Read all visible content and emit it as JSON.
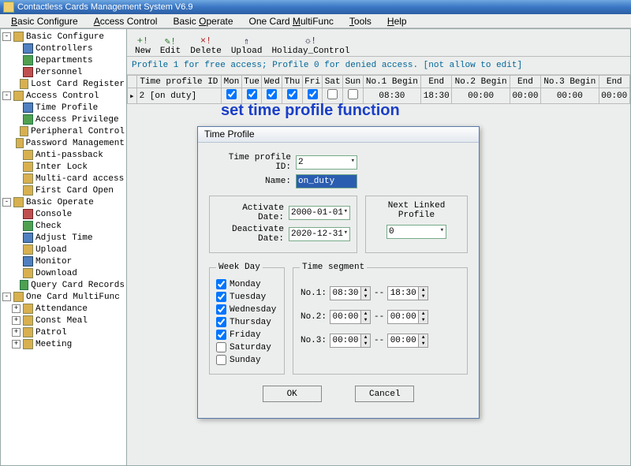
{
  "window": {
    "title": "Contactless Cards Management System  V6.9"
  },
  "menubar": [
    "Basic Configure",
    "Access Control",
    "Basic Operate",
    "One Card MultiFunc",
    "Tools",
    "Help"
  ],
  "menubar_underline": [
    0,
    0,
    6,
    9,
    0,
    0
  ],
  "tree": [
    {
      "depth": 0,
      "exp": "-",
      "ico": "",
      "label": "Basic Configure"
    },
    {
      "depth": 1,
      "exp": "",
      "ico": "blu",
      "label": "Controllers"
    },
    {
      "depth": 1,
      "exp": "",
      "ico": "grn",
      "label": "Departments"
    },
    {
      "depth": 1,
      "exp": "",
      "ico": "red",
      "label": "Personnel"
    },
    {
      "depth": 1,
      "exp": "",
      "ico": "",
      "label": "Lost Card Register"
    },
    {
      "depth": 0,
      "exp": "-",
      "ico": "",
      "label": "Access Control"
    },
    {
      "depth": 1,
      "exp": "",
      "ico": "blu",
      "label": "Time Profile"
    },
    {
      "depth": 1,
      "exp": "",
      "ico": "grn",
      "label": "Access Privilege"
    },
    {
      "depth": 1,
      "exp": "",
      "ico": "",
      "label": "Peripheral Control"
    },
    {
      "depth": 1,
      "exp": "",
      "ico": "",
      "label": "Password Management"
    },
    {
      "depth": 1,
      "exp": "",
      "ico": "",
      "label": "Anti-passback"
    },
    {
      "depth": 1,
      "exp": "",
      "ico": "",
      "label": "Inter Lock"
    },
    {
      "depth": 1,
      "exp": "",
      "ico": "",
      "label": "Multi-card access"
    },
    {
      "depth": 1,
      "exp": "",
      "ico": "",
      "label": "First Card Open"
    },
    {
      "depth": 0,
      "exp": "-",
      "ico": "",
      "label": "Basic Operate"
    },
    {
      "depth": 1,
      "exp": "",
      "ico": "red",
      "label": "Console"
    },
    {
      "depth": 1,
      "exp": "",
      "ico": "grn",
      "label": "Check"
    },
    {
      "depth": 1,
      "exp": "",
      "ico": "blu",
      "label": "Adjust Time"
    },
    {
      "depth": 1,
      "exp": "",
      "ico": "",
      "label": "Upload"
    },
    {
      "depth": 1,
      "exp": "",
      "ico": "blu",
      "label": "Monitor"
    },
    {
      "depth": 1,
      "exp": "",
      "ico": "",
      "label": "Download"
    },
    {
      "depth": 1,
      "exp": "",
      "ico": "grn",
      "label": "Query Card Records"
    },
    {
      "depth": 0,
      "exp": "-",
      "ico": "",
      "label": "One Card MultiFunc"
    },
    {
      "depth": 1,
      "exp": "+",
      "ico": "",
      "label": "Attendance"
    },
    {
      "depth": 1,
      "exp": "+",
      "ico": "",
      "label": "Const Meal"
    },
    {
      "depth": 1,
      "exp": "+",
      "ico": "",
      "label": "Patrol"
    },
    {
      "depth": 1,
      "exp": "+",
      "ico": "",
      "label": "Meeting"
    }
  ],
  "toolbar": [
    {
      "icon": "+!",
      "cls": "",
      "label": "New"
    },
    {
      "icon": "✎!",
      "cls": "",
      "label": "Edit"
    },
    {
      "icon": "×!",
      "cls": "r",
      "label": "Delete"
    },
    {
      "icon": "⇑",
      "cls": "b",
      "label": "Upload"
    },
    {
      "icon": "☼!",
      "cls": "b",
      "label": "Holiday_Control"
    }
  ],
  "hint": "Profile 1 for free access; Profile 0  for denied access.  [not allow to edit]",
  "grid": {
    "headers": [
      "",
      "Time profile ID",
      "Mon",
      "Tue",
      "Wed",
      "Thu",
      "Fri",
      "Sat",
      "Sun",
      "No.1 Begin",
      "End",
      "No.2 Begin",
      "End",
      "No.3 Begin",
      "End"
    ],
    "row": {
      "mark": "▸",
      "id": "2 [on duty]",
      "days": [
        true,
        true,
        true,
        true,
        true,
        false,
        false
      ],
      "t1b": "08:30",
      "t1e": "18:30",
      "t2b": "00:00",
      "t2e": "00:00",
      "t3b": "00:00",
      "t3e": "00:00"
    }
  },
  "heading": "set time profile function",
  "dialog": {
    "title": "Time Profile",
    "labels": {
      "profile_id": "Time profile ID:",
      "name": "Name:",
      "activate": "Activate Date:",
      "deactivate": "Deactivate Date:",
      "next_linked": "Next Linked Profile",
      "weekday": "Week Day",
      "timeseg": "Time segment",
      "no1": "No.1:",
      "no2": "No.2:",
      "no3": "No.3:",
      "ok": "OK",
      "cancel": "Cancel"
    },
    "values": {
      "profile_id": "2",
      "name": "on_duty",
      "activate": "2000-01-01",
      "deactivate": "2020-12-31",
      "next_linked": "0",
      "days": {
        "Monday": true,
        "Tuesday": true,
        "Wednesday": true,
        "Thursday": true,
        "Friday": true,
        "Saturday": false,
        "Sunday": false
      },
      "seg1_begin": "08:30",
      "seg1_end": "18:30",
      "seg2_begin": "00:00",
      "seg2_end": "00:00",
      "seg3_begin": "00:00",
      "seg3_end": "00:00"
    }
  }
}
